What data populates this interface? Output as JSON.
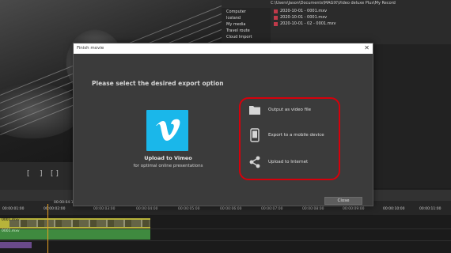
{
  "background_app": {
    "path": "C:\\Users\\Jason\\Documents\\MAGIX\\Video deluxe Plus\\My Record",
    "nav": [
      "Computer",
      "Iceland",
      "My media",
      "Travel route",
      "Cloud Import"
    ],
    "files": [
      "2020-10-01 - 0001.mxv",
      "2020-10-01 - 0001.mxv",
      "2020-10-01 - 02 - 0001.mxv"
    ],
    "timecodes": [
      "00:00:01:00",
      "00:00:04:10",
      "00:00:02:00",
      "00:00:03:00",
      "00:00:04:00",
      "00:00:05:00",
      "00:00:06:00",
      "00:00:07:00",
      "00:00:08:00",
      "00:00:09:00",
      "00:00:10:00",
      "00:00:11:00",
      "00:00:12:00"
    ],
    "track_labels": [
      "0001.mxv",
      "0001.mxv"
    ]
  },
  "dialog": {
    "title": "Finish movie",
    "close_glyph": "✕",
    "heading": "Please select the desired export option",
    "vimeo": {
      "label": "Upload to Vimeo",
      "sublabel": "for optimal online presentations",
      "color": "#1ab7ea",
      "icon": "vimeo-logo"
    },
    "options": [
      {
        "label": "Output as video file",
        "icon": "folder-icon"
      },
      {
        "label": "Export to a mobile device",
        "icon": "smartphone-icon"
      },
      {
        "label": "Upload to Internet",
        "icon": "share-icon"
      }
    ],
    "highlight_color": "#d6000b",
    "close_button": "Close"
  }
}
